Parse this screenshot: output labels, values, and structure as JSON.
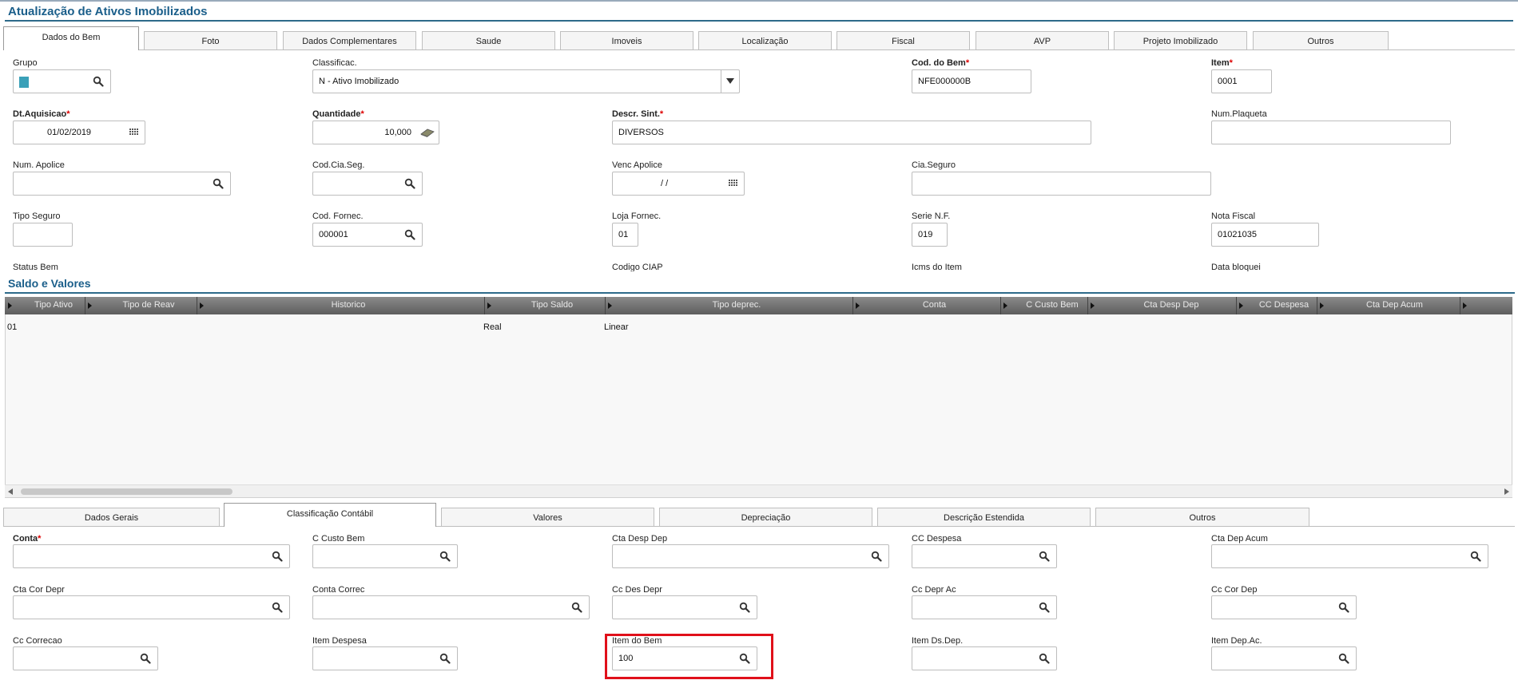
{
  "window": {
    "title": "Atualização de Ativos Imobilizados"
  },
  "top_tabs": [
    {
      "label": "Dados do Bem",
      "active": true
    },
    {
      "label": "Foto"
    },
    {
      "label": "Dados Complementares"
    },
    {
      "label": "Saude"
    },
    {
      "label": "Imoveis"
    },
    {
      "label": "Localização"
    },
    {
      "label": "Fiscal"
    },
    {
      "label": "AVP"
    },
    {
      "label": "Projeto Imobilizado"
    },
    {
      "label": "Outros"
    }
  ],
  "dados_bem": {
    "grupo": {
      "label": "Grupo",
      "value": ""
    },
    "classificac": {
      "label": "Classificac.",
      "value": "N - Ativo Imobilizado"
    },
    "cod_bem": {
      "label": "Cod. do Bem",
      "value": "NFE000000B"
    },
    "item": {
      "label": "Item",
      "value": "0001"
    },
    "dt_aquisicao": {
      "label": "Dt.Aquisicao",
      "value": "01/02/2019"
    },
    "quantidade": {
      "label": "Quantidade",
      "value": "10,000"
    },
    "descr_sint": {
      "label": "Descr. Sint.",
      "value": "DIVERSOS"
    },
    "num_plaqueta": {
      "label": "Num.Plaqueta",
      "value": ""
    },
    "num_apolice": {
      "label": "Num. Apolice",
      "value": ""
    },
    "cod_cia_seg": {
      "label": "Cod.Cia.Seg.",
      "value": ""
    },
    "venc_apolice": {
      "label": "Venc Apolice",
      "value": "/ /"
    },
    "cia_seguro": {
      "label": "Cia.Seguro",
      "value": ""
    },
    "tipo_seguro": {
      "label": "Tipo Seguro",
      "value": ""
    },
    "cod_fornec": {
      "label": "Cod. Fornec.",
      "value": "000001"
    },
    "loja_fornec": {
      "label": "Loja Fornec.",
      "value": "01"
    },
    "serie_nf": {
      "label": "Serie N.F.",
      "value": "019"
    },
    "nota_fiscal": {
      "label": "Nota Fiscal",
      "value": "01021035"
    },
    "status_bem": {
      "label": "Status Bem"
    },
    "codigo_ciap": {
      "label": "Codigo CIAP"
    },
    "icms_item": {
      "label": "Icms do Item"
    },
    "data_bloqueio": {
      "label": "Data bloquei"
    }
  },
  "saldo": {
    "title": "Saldo e Valores",
    "columns": [
      "Tipo Ativo",
      "Tipo de Reav",
      "Historico",
      "Tipo Saldo",
      "Tipo deprec.",
      "Conta",
      "C Custo Bem",
      "Cta Desp Dep",
      "CC Despesa",
      "Cta Dep Acum"
    ],
    "rows": [
      {
        "tipo_ativo": "01",
        "tipo_saldo": "Real",
        "tipo_deprec": "Linear"
      }
    ]
  },
  "bottom_tabs": [
    {
      "label": "Dados Gerais"
    },
    {
      "label": "Classificação Contábil",
      "active": true
    },
    {
      "label": "Valores"
    },
    {
      "label": "Depreciação"
    },
    {
      "label": "Descrição Estendida"
    },
    {
      "label": "Outros"
    }
  ],
  "contabil": {
    "conta": {
      "label": "Conta",
      "value": ""
    },
    "c_custo_bem": {
      "label": "C Custo Bem",
      "value": ""
    },
    "cta_desp_dep": {
      "label": "Cta Desp Dep",
      "value": ""
    },
    "cc_despesa": {
      "label": "CC Despesa",
      "value": ""
    },
    "cta_dep_acum": {
      "label": "Cta Dep Acum",
      "value": ""
    },
    "cta_cor_depr": {
      "label": "Cta Cor Depr",
      "value": ""
    },
    "conta_correc": {
      "label": "Conta Correc",
      "value": ""
    },
    "cc_des_depr": {
      "label": "Cc Des Depr",
      "value": ""
    },
    "cc_depr_ac": {
      "label": "Cc Depr Ac",
      "value": ""
    },
    "cc_cor_dep": {
      "label": "Cc Cor Dep",
      "value": ""
    },
    "cc_correcao": {
      "label": "Cc Correcao",
      "value": ""
    },
    "item_despesa": {
      "label": "Item Despesa",
      "value": ""
    },
    "item_do_bem": {
      "label": "Item do Bem",
      "value": "100"
    },
    "item_ds_dep": {
      "label": "Item Ds.Dep.",
      "value": ""
    },
    "item_dep_ac": {
      "label": "Item Dep.Ac.",
      "value": ""
    }
  },
  "colors": {
    "accent": "#1a5e8a",
    "highlight": "#e0101a",
    "grid_header": "#6a6a6a"
  }
}
